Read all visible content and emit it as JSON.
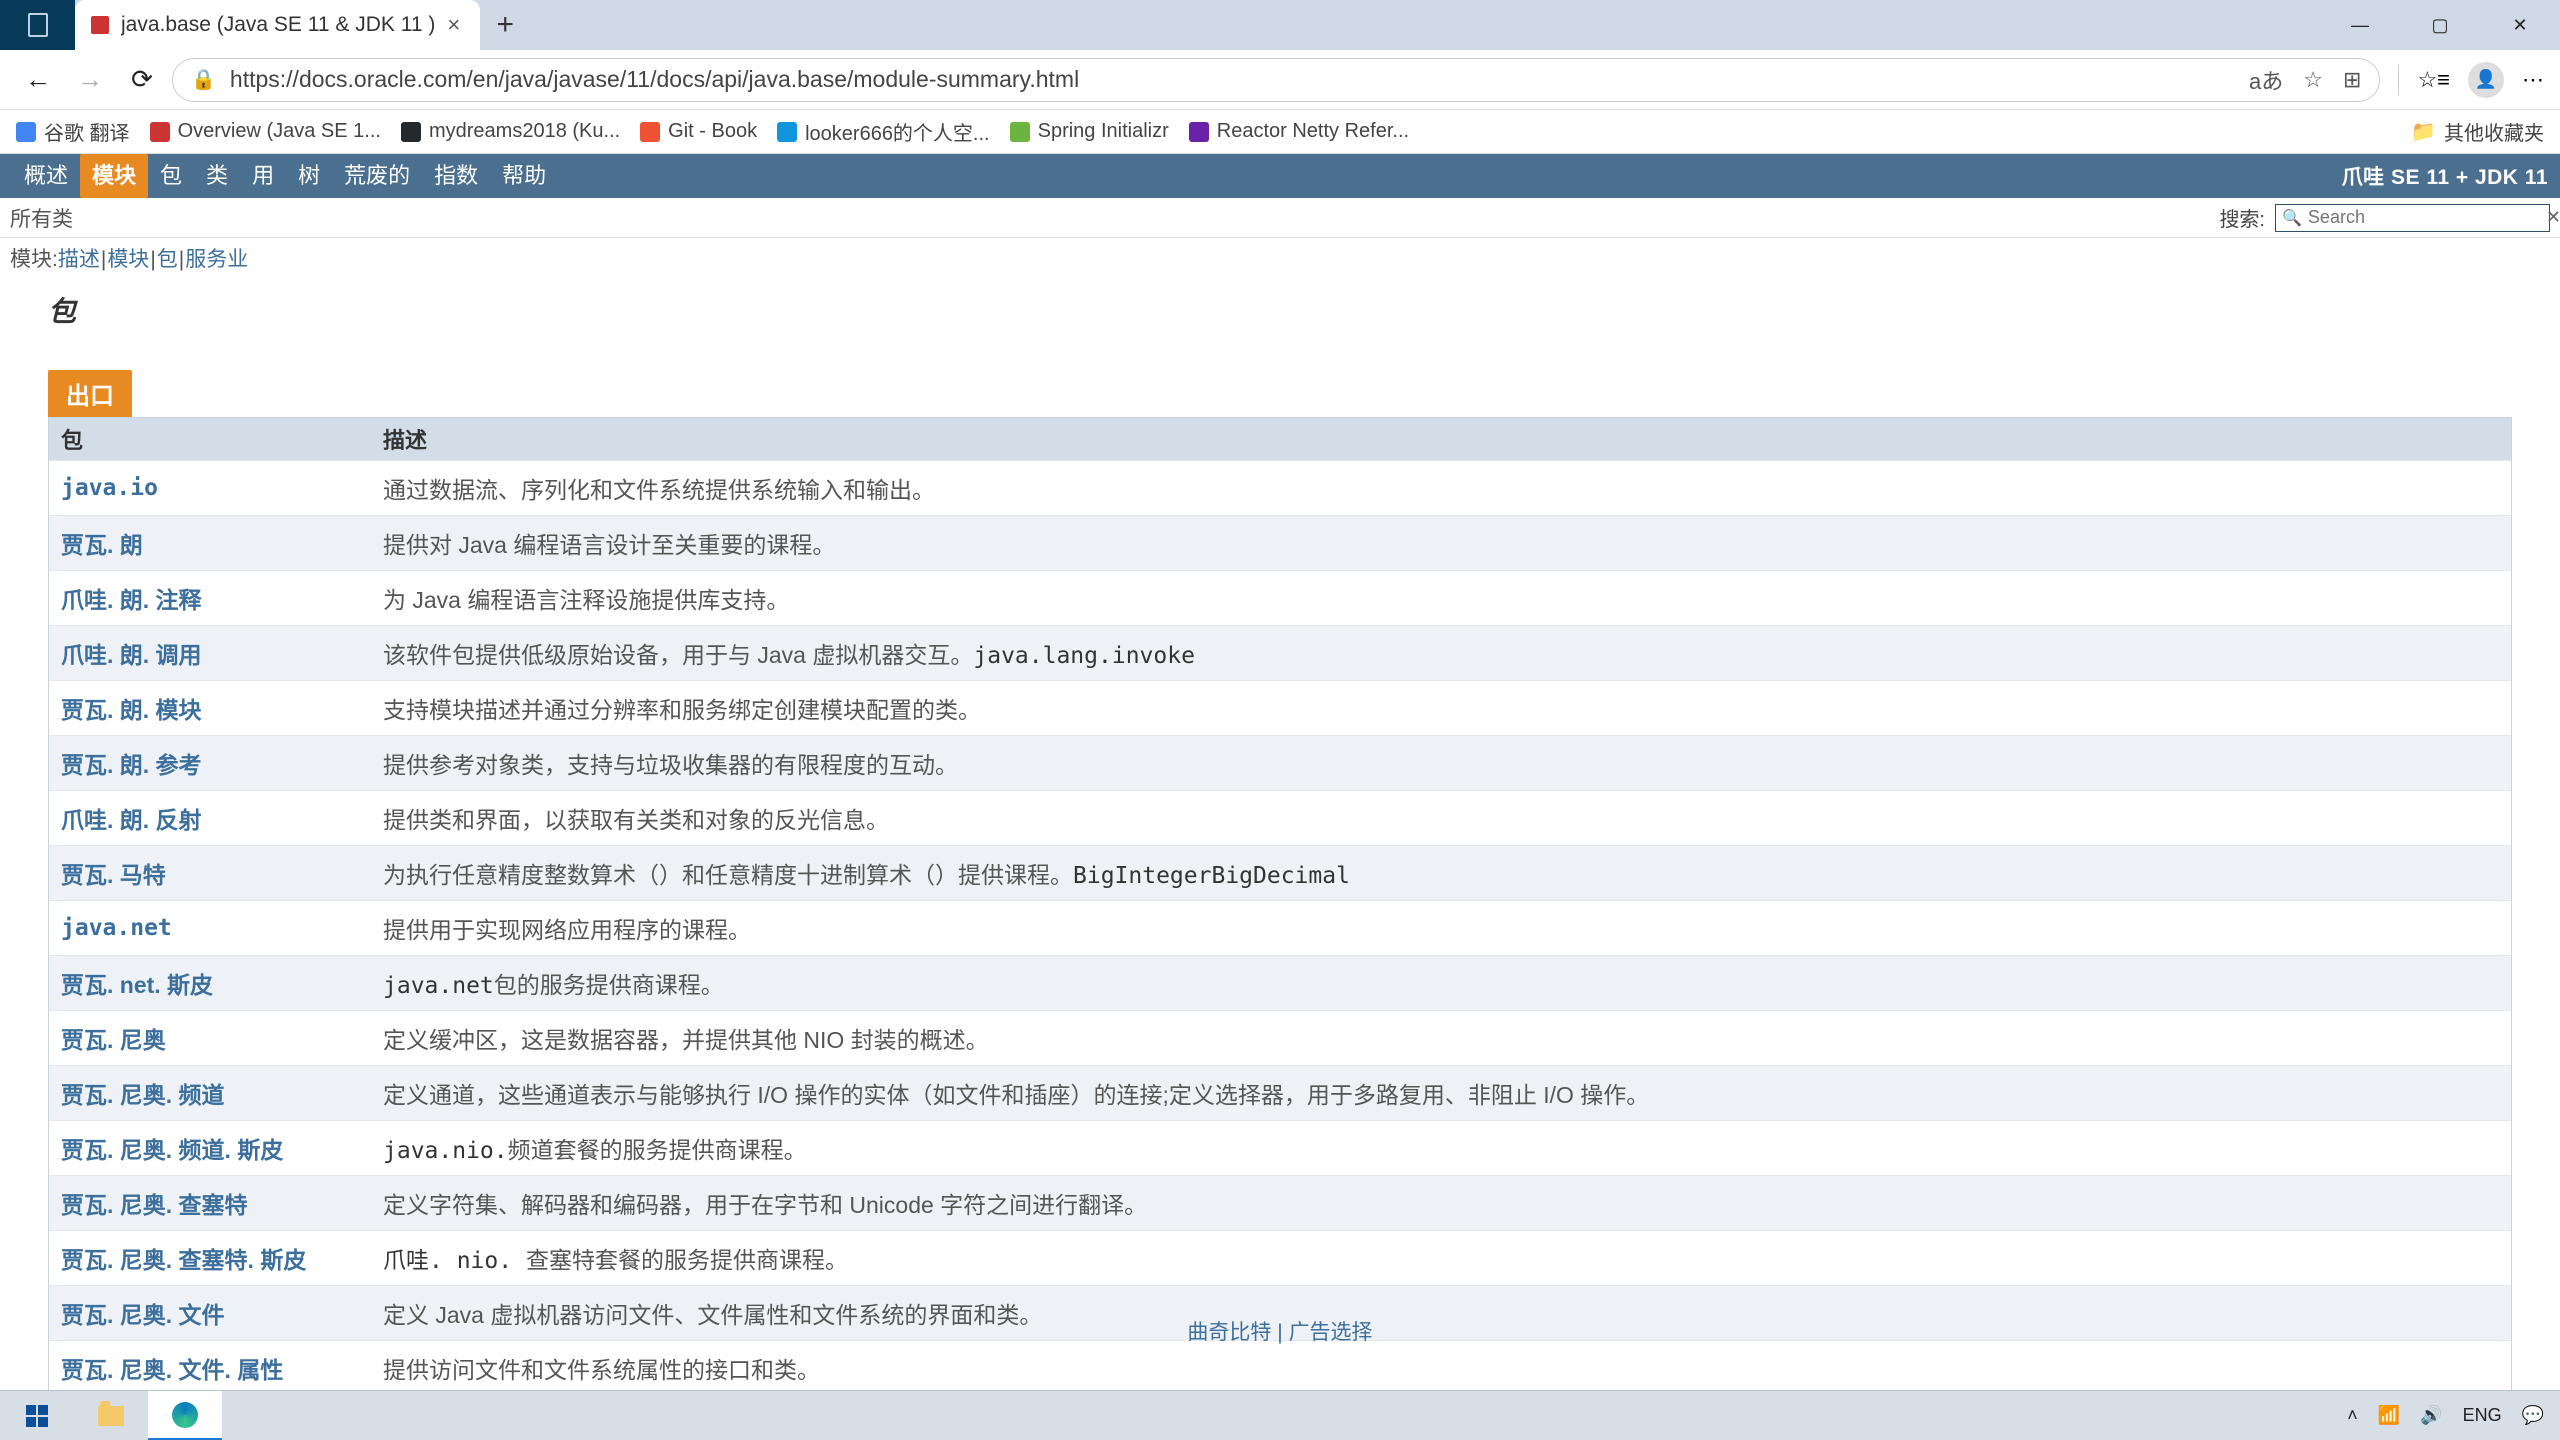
{
  "browser": {
    "tab_title": "java.base (Java SE 11 & JDK 11 )",
    "url": "https://docs.oracle.com/en/java/javase/11/docs/api/java.base/module-summary.html",
    "bookmarks": [
      {
        "label": "谷歌 翻译",
        "color": "#4285f4"
      },
      {
        "label": "Overview (Java SE 1...",
        "color": "#c33"
      },
      {
        "label": "mydreams2018 (Ku...",
        "color": "#24292e"
      },
      {
        "label": "Git - Book",
        "color": "#f05133"
      },
      {
        "label": "looker666的个人空...",
        "color": "#1296db"
      },
      {
        "label": "Spring Initializr",
        "color": "#6db33f"
      },
      {
        "label": "Reactor Netty Refer...",
        "color": "#6b21a8"
      }
    ],
    "other_bookmarks": "其他收藏夹"
  },
  "topnav": {
    "items": [
      "概述",
      "模块",
      "包",
      "类",
      "用",
      "树",
      "荒废的",
      "指数",
      "帮助"
    ],
    "right": "爪哇 SE 11 + JDK 11"
  },
  "sub": {
    "all_classes": "所有类",
    "search_label": "搜索:",
    "search_placeholder": "Search"
  },
  "module_line": {
    "prefix": "模块: ",
    "parts": [
      "描述",
      "模块",
      "包",
      "服务业"
    ]
  },
  "section_heading": "包",
  "tabstrip": "出口",
  "table": {
    "headers": {
      "pkg": "包",
      "desc": "描述"
    },
    "rows": [
      {
        "name": "java.io",
        "code": true,
        "desc_plain": "通过数据流、序列化和文件系统提供系统输入和输出。"
      },
      {
        "name": "贾瓦. 朗",
        "desc_plain": "提供对 Java 编程语言设计至关重要的课程。"
      },
      {
        "name": "爪哇. 朗. 注释",
        "desc_plain": "为 Java 编程语言注释设施提供库支持。"
      },
      {
        "name": "爪哇. 朗. 调用",
        "desc_pre": "该软件包提供低级原始设备，用于与 Java 虚拟机器交互。",
        "mono": "java.lang.invoke"
      },
      {
        "name": "贾瓦. 朗. 模块",
        "desc_plain": "支持模块描述并通过分辨率和服务绑定创建模块配置的类。"
      },
      {
        "name": "贾瓦. 朗. 参考",
        "desc_plain": "提供参考对象类，支持与垃圾收集器的有限程度的互动。"
      },
      {
        "name": "爪哇. 朗. 反射",
        "desc_plain": "提供类和界面，以获取有关类和对象的反光信息。"
      },
      {
        "name": "贾瓦. 马特",
        "desc_pre": "为执行任意精度整数算术（）和任意精度十进制算术（）提供课程。",
        "mono": "BigIntegerBigDecimal"
      },
      {
        "name": "java.net",
        "code": true,
        "desc_plain": "提供用于实现网络应用程序的课程。"
      },
      {
        "name": "贾瓦. net. 斯皮",
        "desc_mono_first": "java.net",
        "desc_post": "包的服务提供商课程。"
      },
      {
        "name": "贾瓦. 尼奥",
        "desc_plain": "定义缓冲区，这是数据容器，并提供其他 NIO 封装的概述。"
      },
      {
        "name": "贾瓦. 尼奥. 频道",
        "desc_plain": "定义通道，这些通道表示与能够执行 I/O 操作的实体（如文件和插座）的连接;定义选择器，用于多路复用、非阻止 I/O 操作。"
      },
      {
        "name": "贾瓦. 尼奥. 频道. 斯皮",
        "desc_mono_first": "java.nio.",
        "desc_post": "频道套餐的服务提供商课程。"
      },
      {
        "name": "贾瓦. 尼奥. 查塞特",
        "desc_plain": "定义字符集、解码器和编码器，用于在字节和 Unicode 字符之间进行翻译。"
      },
      {
        "name": "贾瓦. 尼奥. 查塞特. 斯皮",
        "desc_mono_first": "爪哇. nio. ",
        "desc_post": "查塞特套餐的服务提供商课程。"
      },
      {
        "name": "贾瓦. 尼奥. 文件",
        "desc_plain": "定义 Java 虚拟机器访问文件、文件属性和文件系统的界面和类。"
      },
      {
        "name": "贾瓦. 尼奥. 文件. 属性",
        "desc_plain": "提供访问文件和文件系统属性的接口和类。"
      }
    ]
  },
  "footer": {
    "left": "曲奇比特",
    "right": "广告选择"
  },
  "taskbar": {
    "lang": "ENG"
  }
}
